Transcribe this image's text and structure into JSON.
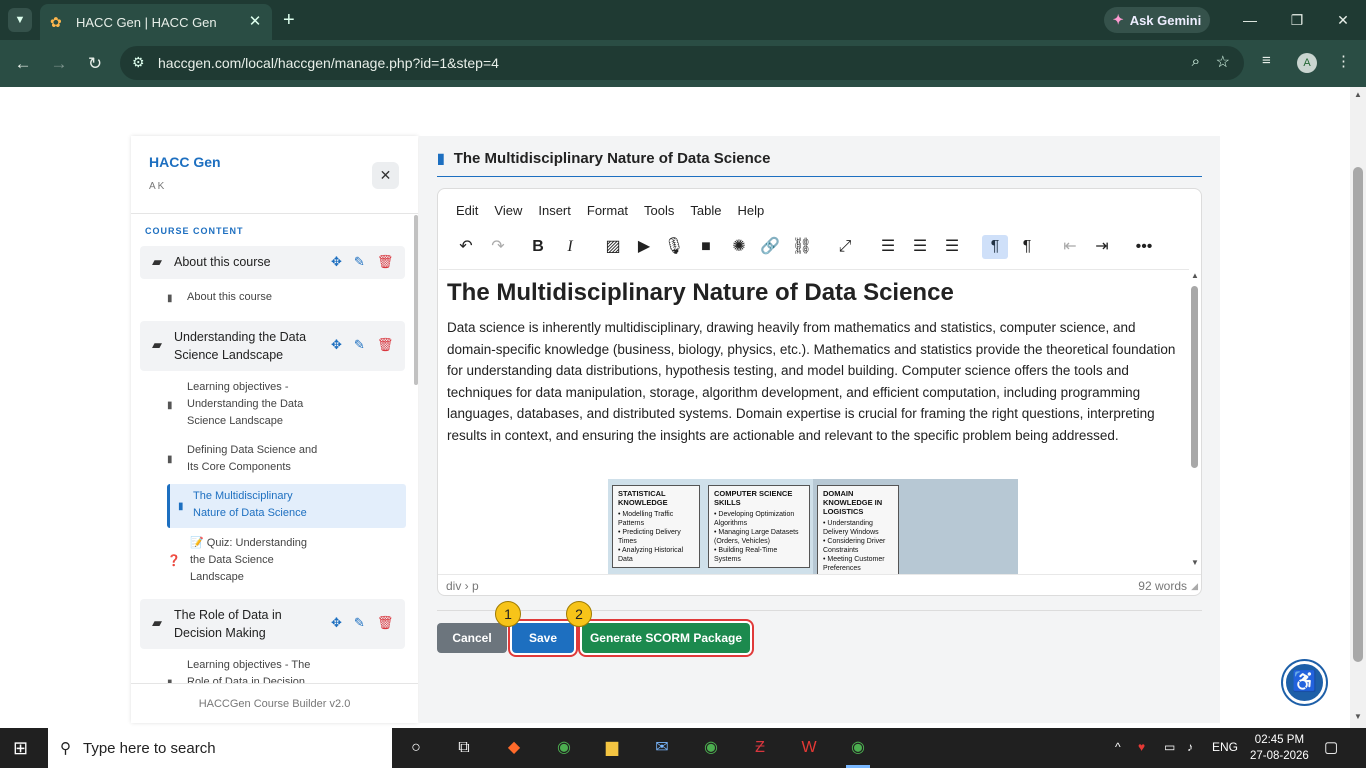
{
  "browser": {
    "tab_title": "HACC Gen | HACC Gen",
    "gemini_label": "Ask Gemini",
    "url": "haccgen.com/local/haccgen/manage.php?id=1&step=4",
    "profile_initial": "A"
  },
  "sidebar": {
    "title": "HACC Gen",
    "subtitle": "AK",
    "section_label": "COURSE CONTENT",
    "sections": [
      {
        "title": "About this course",
        "items": [
          {
            "label": "About this course"
          }
        ]
      },
      {
        "title": "Understanding the Data Science Landscape",
        "items": [
          {
            "label": "Learning objectives - Understanding the Data Science Landscape"
          },
          {
            "label": "Defining Data Science and Its Core Components"
          },
          {
            "label": "The Multidisciplinary Nature of Data Science",
            "active": true
          },
          {
            "label": "Quiz: Understanding the Data Science Landscape"
          }
        ]
      },
      {
        "title": "The Role of Data in Decision Making",
        "items": [
          {
            "label": "Learning objectives - The Role of Data in Decision"
          }
        ]
      }
    ],
    "footer": "HACCGen Course Builder v2.0"
  },
  "main": {
    "title": "The Multidisciplinary Nature of Data Science",
    "menu": [
      "Edit",
      "View",
      "Insert",
      "Format",
      "Tools",
      "Table",
      "Help"
    ],
    "content_heading": "The Multidisciplinary Nature of Data Science",
    "content_paragraph": "Data science is inherently multidisciplinary, drawing heavily from mathematics and statistics, computer science, and domain-specific knowledge (business, biology, physics, etc.). Mathematics and statistics provide the theoretical foundation for understanding data distributions, hypothesis testing, and model building. Computer science offers the tools and techniques for data manipulation, storage, algorithm development, and efficient computation, including programming languages, databases, and distributed systems. Domain expertise is crucial for framing the right questions, interpreting results in context, and ensuring the insights are actionable and relevant to the specific problem being addressed.",
    "illustration": {
      "panel1_title": "STATISTICAL KNOWLEDGE",
      "panel1_items": [
        "• Modelling Traffic Patterns",
        "• Predicting Delivery Times",
        "• Analyzing Historical Data"
      ],
      "panel2_title": "COMPUTER SCIENCE SKILLS",
      "panel2_items": [
        "• Developing Optimization Algorithms",
        "• Managing Large Datasets (Orders, Vehicles)",
        "• Building Real-Time Systems"
      ],
      "panel3_title": "DOMAIN KNOWLEDGE IN LOGISTICS",
      "panel3_items": [
        "• Understanding Delivery Windows",
        "• Considering Driver Constraints",
        "• Meeting Customer Preferences"
      ]
    },
    "status_path": "div › p",
    "word_count": "92 words",
    "buttons": {
      "cancel": "Cancel",
      "save": "Save",
      "scorm": "Generate SCORM Package"
    },
    "markers": [
      "1",
      "2"
    ]
  },
  "taskbar": {
    "search_placeholder": "Type here to search",
    "lang": "ENG",
    "time": "02:45 PM",
    "date": "27-08-2026"
  },
  "colors": {
    "accent": "#1d6fc0",
    "save": "#1d6fc0",
    "scorm": "#1c8a4e",
    "cancel": "#6c757d",
    "delete": "#d9363e",
    "chrome": "#2a4d44"
  }
}
